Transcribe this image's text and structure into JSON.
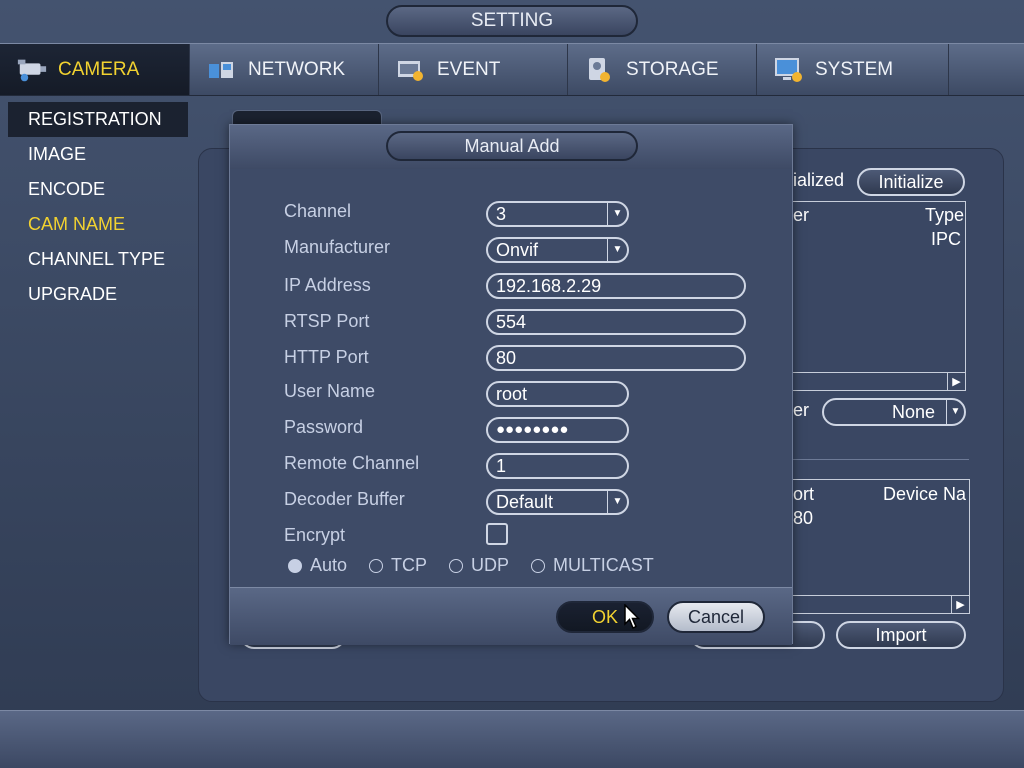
{
  "window": {
    "title": "SETTING"
  },
  "tabs": [
    {
      "label": "CAMERA",
      "icon": "camera-icon",
      "active": true
    },
    {
      "label": "NETWORK",
      "icon": "network-icon",
      "active": false
    },
    {
      "label": "EVENT",
      "icon": "event-icon",
      "active": false
    },
    {
      "label": "STORAGE",
      "icon": "storage-icon",
      "active": false
    },
    {
      "label": "SYSTEM",
      "icon": "system-icon",
      "active": false
    }
  ],
  "sidebar": {
    "items": [
      {
        "label": "REGISTRATION",
        "selected": true
      },
      {
        "label": "IMAGE"
      },
      {
        "label": "ENCODE"
      },
      {
        "label": "CAM NAME"
      },
      {
        "label": "CHANNEL TYPE"
      },
      {
        "label": "UPGRADE"
      }
    ]
  },
  "background": {
    "initialized_fragment": "ialized",
    "initialize_label": "Initialize",
    "list1_col_fragment": "er",
    "list1_type_header": "Type",
    "list1_type_value": "IPC",
    "filter_fragment": "er",
    "filter_value": "None",
    "list2_port_fragment": "ort",
    "list2_device_header": "Device Na",
    "list2_port_value": "80",
    "import_label": "Import"
  },
  "dialog": {
    "title": "Manual Add",
    "fields": {
      "channel": {
        "label": "Channel",
        "value": "3"
      },
      "manufacturer": {
        "label": "Manufacturer",
        "value": "Onvif"
      },
      "ip_address": {
        "label": "IP Address",
        "value": "192.168.2.29"
      },
      "rtsp_port": {
        "label": "RTSP Port",
        "value": "554"
      },
      "http_port": {
        "label": "HTTP Port",
        "value": "80"
      },
      "user_name": {
        "label": "User Name",
        "value": "root"
      },
      "password": {
        "label": "Password",
        "value": "●●●●●●●●"
      },
      "remote_channel": {
        "label": "Remote Channel",
        "value": "1"
      },
      "decoder_buffer": {
        "label": "Decoder Buffer",
        "value": "Default"
      },
      "encrypt": {
        "label": "Encrypt",
        "checked": false
      }
    },
    "protocols": [
      {
        "label": "Auto",
        "checked": true
      },
      {
        "label": "TCP",
        "checked": false
      },
      {
        "label": "UDP",
        "checked": false
      },
      {
        "label": "MULTICAST",
        "checked": false
      }
    ],
    "ok_label": "OK",
    "cancel_label": "Cancel"
  },
  "colors": {
    "accent": "#f2d230",
    "panel": "#3e4b67",
    "label": "#c7d0e4"
  }
}
